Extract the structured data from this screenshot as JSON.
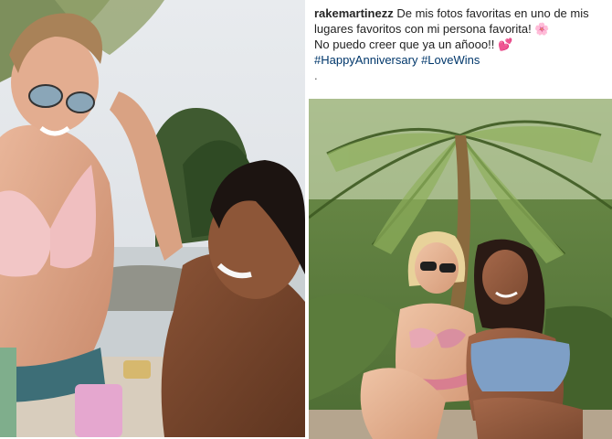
{
  "caption": {
    "username": "rakemartinezz",
    "line1_text": "De mis fotos favoritas en uno de mis",
    "line2_text": "lugares favoritos con mi persona favorita!",
    "line2_emoji": "🌸",
    "line3_text": "No puedo creer que ya un añooo!!",
    "line3_emoji": "💕",
    "hashtag1": "#HappyAnniversary",
    "hashtag2": "#LoveWins",
    "trailing": "."
  },
  "colors": {
    "hashtag": "#00376b",
    "emoji_pink": "#f06292"
  },
  "icons": [
    "flower-emoji-icon",
    "hearts-emoji-icon"
  ]
}
